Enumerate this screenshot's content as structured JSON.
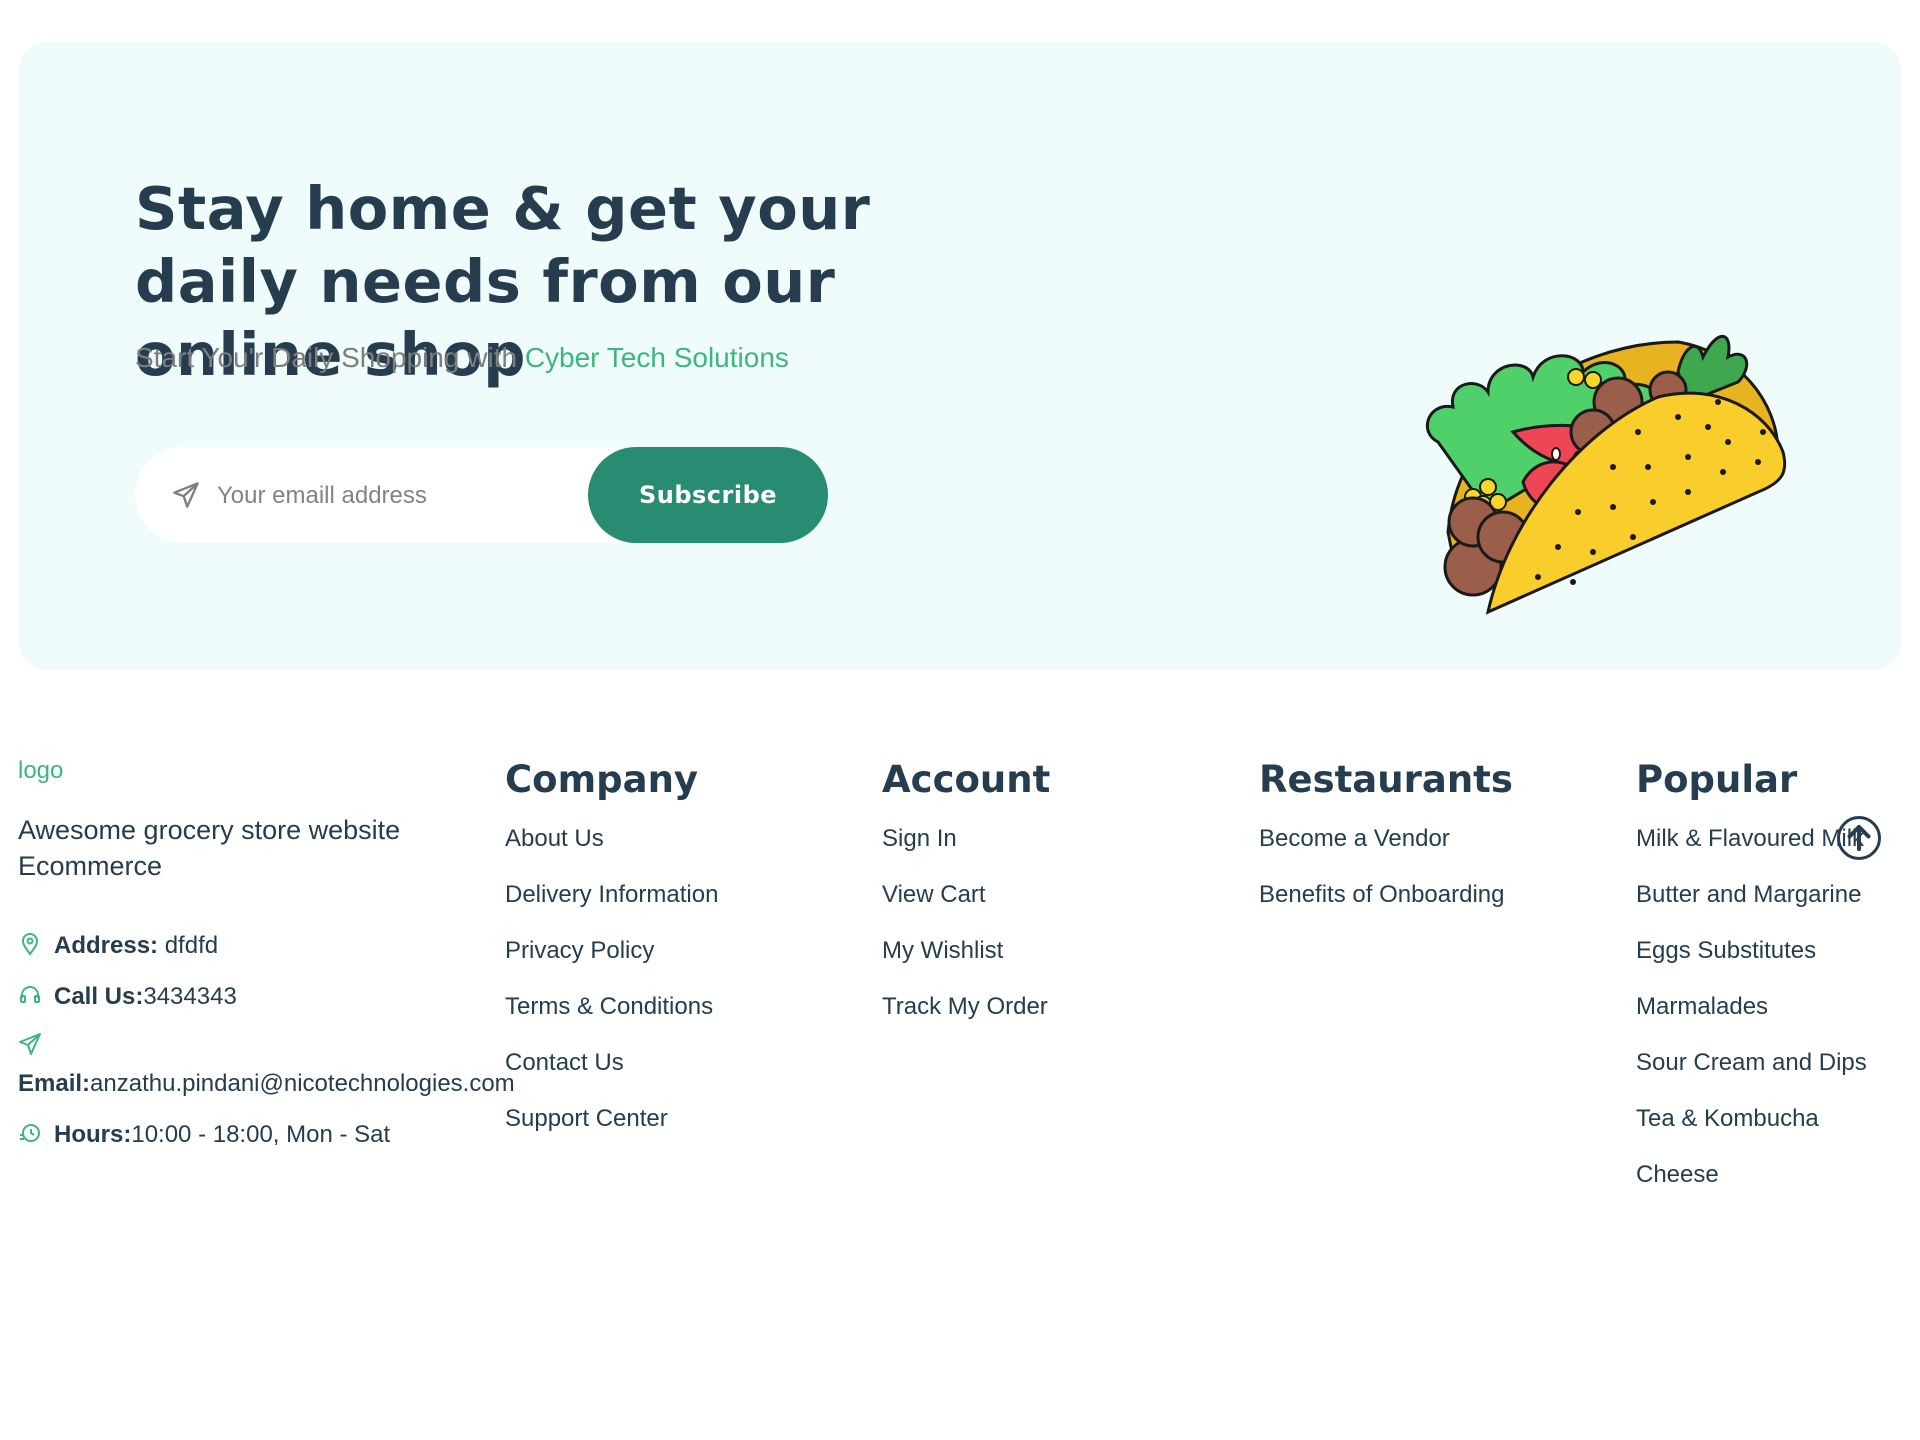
{
  "newsletter": {
    "title": "Stay home & get your daily needs from our online shop",
    "subtitle_prefix": "Start You'r Daily Shopping with ",
    "subtitle_brand": "Cyber Tech Solutions",
    "email_placeholder": "Your emaill address",
    "subscribe_label": "Subscribe",
    "illustration": "taco-illustration"
  },
  "footer": {
    "logo_text": "logo",
    "description": "Awesome grocery store website Ecommerce",
    "contact": {
      "address_label": "Address:",
      "address_value": " dfdfd",
      "call_label": "Call Us:",
      "call_value": "3434343",
      "email_label": "Email:",
      "email_value": "anzathu.pindani@nicotechnologies.com",
      "hours_label": "Hours:",
      "hours_value": "10:00 - 18:00, Mon - Sat"
    },
    "columns": [
      {
        "title": "Company",
        "links": [
          "About Us",
          "Delivery Information",
          "Privacy Policy",
          "Terms & Conditions",
          "Contact Us",
          "Support Center"
        ]
      },
      {
        "title": "Account",
        "links": [
          "Sign In",
          "View Cart",
          "My Wishlist",
          "Track My Order"
        ]
      },
      {
        "title": "Restaurants",
        "links": [
          "Become a Vendor",
          "Benefits of Onboarding"
        ]
      },
      {
        "title": "Popular",
        "links": [
          "Milk & Flavoured Milk",
          "Butter and Margarine",
          "Eggs Substitutes",
          "Marmalades",
          "Sour Cream and Dips",
          "Tea & Kombucha",
          "Cheese"
        ]
      }
    ]
  },
  "colors": {
    "primary_text": "#253d4e",
    "accent_green": "#3bb77e",
    "button_bg": "#278c72",
    "banner_bg": "#effcfb"
  },
  "icons": [
    "send-icon",
    "location-pin-icon",
    "headset-icon",
    "send-icon",
    "clock-icon",
    "arrow-up-icon"
  ]
}
